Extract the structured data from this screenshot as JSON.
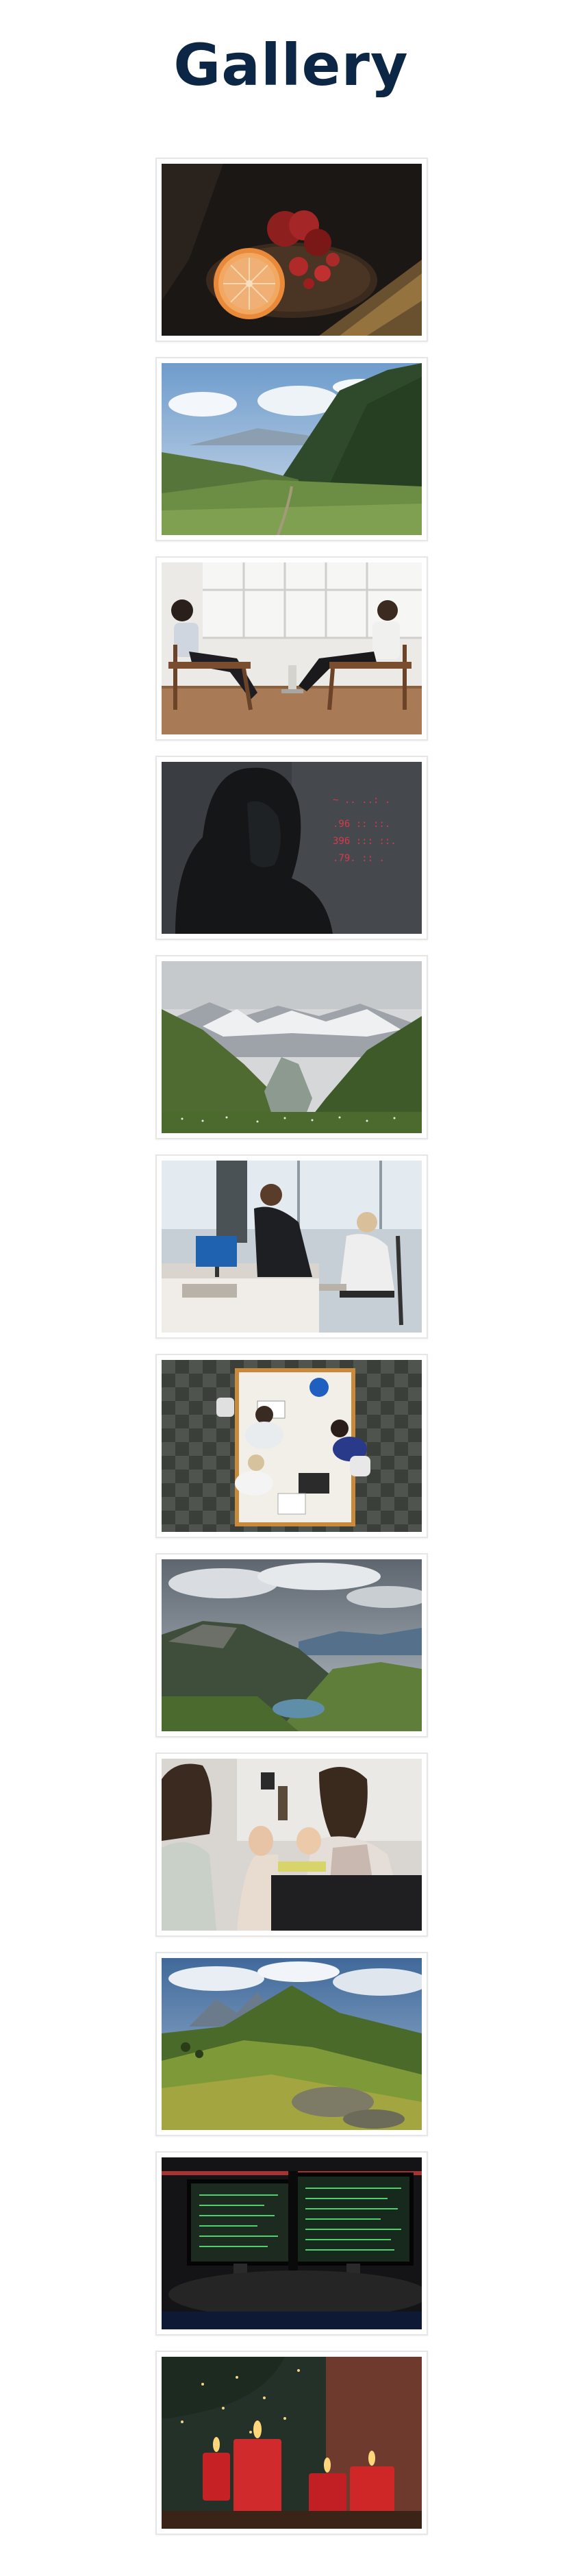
{
  "page": {
    "title": "Gallery"
  },
  "gallery": {
    "items": [
      {
        "name": "photo-grapefruit-pomegranate",
        "icon": "image-icon"
      },
      {
        "name": "photo-mountain-valley-meadow",
        "icon": "image-icon"
      },
      {
        "name": "photo-therapy-session",
        "icon": "image-icon"
      },
      {
        "name": "photo-hooded-hacker",
        "icon": "image-icon"
      },
      {
        "name": "photo-snowy-mountain-valley",
        "icon": "image-icon"
      },
      {
        "name": "photo-office-meeting",
        "icon": "image-icon"
      },
      {
        "name": "photo-overhead-desk-team",
        "icon": "image-icon"
      },
      {
        "name": "photo-mountain-lake",
        "icon": "image-icon"
      },
      {
        "name": "photo-conversation-women",
        "icon": "image-icon"
      },
      {
        "name": "photo-green-mountain-slopes",
        "icon": "image-icon"
      },
      {
        "name": "photo-trading-monitors",
        "icon": "image-icon"
      },
      {
        "name": "photo-red-candles",
        "icon": "image-icon"
      }
    ]
  },
  "colors": {
    "title": "#0b2745",
    "card_border": "#e6e6e6",
    "background": "#ffffff"
  }
}
